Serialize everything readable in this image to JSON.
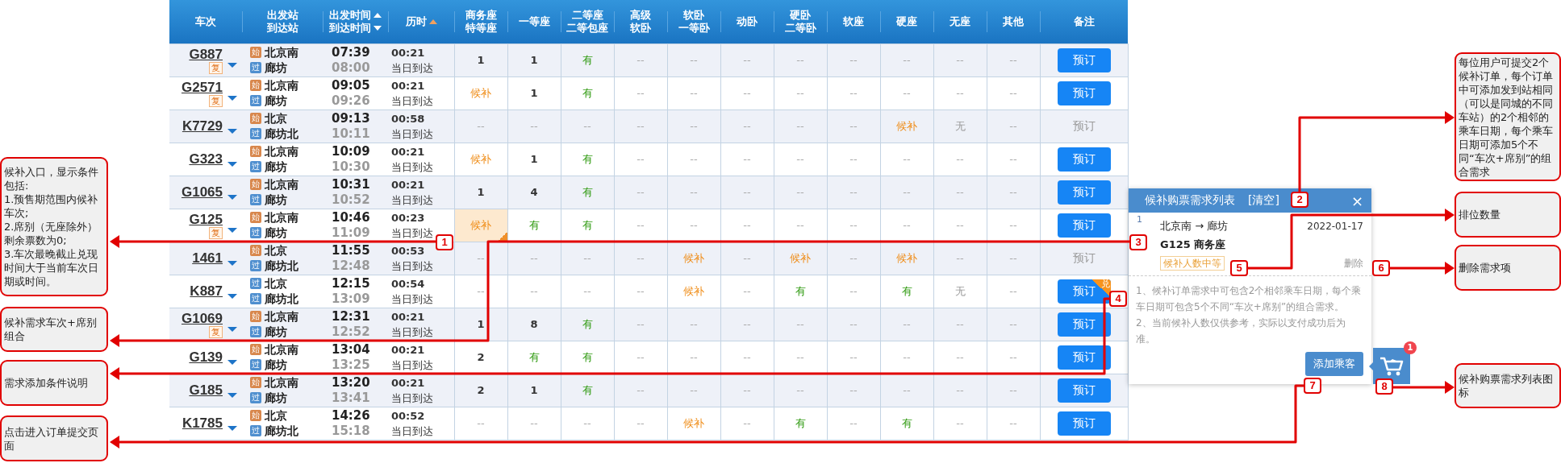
{
  "table": {
    "columns": [
      {
        "lines": [
          {
            "text": "车次",
            "kind": "plain"
          }
        ]
      },
      {
        "lines": [
          {
            "text": "出发站",
            "kind": "plain"
          },
          {
            "text": "到达站",
            "kind": "plain"
          }
        ]
      },
      {
        "lines": [
          {
            "text": "出发时间",
            "kind": "sort-up",
            "active": false
          },
          {
            "text": "到达时间",
            "kind": "sort-down",
            "active": false
          }
        ]
      },
      {
        "lines": [
          {
            "text": "历时",
            "kind": "sort-up",
            "active": true
          }
        ]
      },
      {
        "lines": [
          {
            "text": "商务座",
            "kind": "plain"
          },
          {
            "text": "特等座",
            "kind": "plain"
          }
        ]
      },
      {
        "lines": [
          {
            "text": "一等座",
            "kind": "plain"
          }
        ]
      },
      {
        "lines": [
          {
            "text": "二等座",
            "kind": "plain"
          },
          {
            "text": "二等包座",
            "kind": "plain"
          }
        ]
      },
      {
        "lines": [
          {
            "text": "高级",
            "kind": "plain"
          },
          {
            "text": "软卧",
            "kind": "plain"
          }
        ]
      },
      {
        "lines": [
          {
            "text": "软卧",
            "kind": "plain"
          },
          {
            "text": "一等卧",
            "kind": "plain"
          }
        ]
      },
      {
        "lines": [
          {
            "text": "动卧",
            "kind": "plain"
          }
        ]
      },
      {
        "lines": [
          {
            "text": "硬卧",
            "kind": "plain"
          },
          {
            "text": "二等卧",
            "kind": "plain"
          }
        ]
      },
      {
        "lines": [
          {
            "text": "软座",
            "kind": "plain"
          }
        ]
      },
      {
        "lines": [
          {
            "text": "硬座",
            "kind": "plain"
          }
        ]
      },
      {
        "lines": [
          {
            "text": "无座",
            "kind": "plain"
          }
        ]
      },
      {
        "lines": [
          {
            "text": "其他",
            "kind": "plain"
          }
        ]
      },
      {
        "lines": [
          {
            "text": "备注",
            "kind": "plain"
          }
        ]
      }
    ],
    "rows": [
      {
        "train": "G887",
        "badge": "复",
        "from": {
          "tag": "始",
          "kind": "start",
          "name": "北京南"
        },
        "to": {
          "tag": "过",
          "kind": "pass",
          "name": "廊坊"
        },
        "depart": "07:39",
        "arrive": "08:00",
        "duration": "00:21",
        "arrival_day": "当日到达",
        "seats": [
          {
            "t": "1",
            "kind": "num",
            "selected": false
          },
          {
            "t": "1",
            "kind": "num",
            "selected": false
          },
          {
            "t": "有",
            "kind": "yes",
            "selected": false
          },
          {
            "t": "--",
            "kind": "none",
            "selected": false
          },
          {
            "t": "--",
            "kind": "none",
            "selected": false
          },
          {
            "t": "--",
            "kind": "none",
            "selected": false
          },
          {
            "t": "--",
            "kind": "none",
            "selected": false
          },
          {
            "t": "--",
            "kind": "none",
            "selected": false
          },
          {
            "t": "--",
            "kind": "none",
            "selected": false
          },
          {
            "t": "--",
            "kind": "none",
            "selected": false
          },
          {
            "t": "--",
            "kind": "none",
            "selected": false
          }
        ],
        "book": {
          "label": "预订",
          "disabled": false
        }
      },
      {
        "train": "G2571",
        "badge": "复",
        "from": {
          "tag": "始",
          "kind": "start",
          "name": "北京南"
        },
        "to": {
          "tag": "过",
          "kind": "pass",
          "name": "廊坊"
        },
        "depart": "09:05",
        "arrive": "09:26",
        "duration": "00:21",
        "arrival_day": "当日到达",
        "seats": [
          {
            "t": "候补",
            "kind": "wait",
            "selected": false
          },
          {
            "t": "1",
            "kind": "num",
            "selected": false
          },
          {
            "t": "有",
            "kind": "yes",
            "selected": false
          },
          {
            "t": "--",
            "kind": "none",
            "selected": false
          },
          {
            "t": "--",
            "kind": "none",
            "selected": false
          },
          {
            "t": "--",
            "kind": "none",
            "selected": false
          },
          {
            "t": "--",
            "kind": "none",
            "selected": false
          },
          {
            "t": "--",
            "kind": "none",
            "selected": false
          },
          {
            "t": "--",
            "kind": "none",
            "selected": false
          },
          {
            "t": "--",
            "kind": "none",
            "selected": false
          },
          {
            "t": "--",
            "kind": "none",
            "selected": false
          }
        ],
        "book": {
          "label": "预订",
          "disabled": false
        }
      },
      {
        "train": "K7729",
        "from": {
          "tag": "始",
          "kind": "start",
          "name": "北京"
        },
        "to": {
          "tag": "过",
          "kind": "pass",
          "name": "廊坊北"
        },
        "depart": "09:13",
        "arrive": "10:11",
        "duration": "00:58",
        "arrival_day": "当日到达",
        "seats": [
          {
            "t": "--",
            "kind": "none",
            "selected": false
          },
          {
            "t": "--",
            "kind": "none",
            "selected": false
          },
          {
            "t": "--",
            "kind": "none",
            "selected": false
          },
          {
            "t": "--",
            "kind": "none",
            "selected": false
          },
          {
            "t": "--",
            "kind": "none",
            "selected": false
          },
          {
            "t": "--",
            "kind": "none",
            "selected": false
          },
          {
            "t": "--",
            "kind": "none",
            "selected": false
          },
          {
            "t": "--",
            "kind": "none",
            "selected": false
          },
          {
            "t": "候补",
            "kind": "wait",
            "selected": false
          },
          {
            "t": "无",
            "kind": "no",
            "selected": false
          },
          {
            "t": "--",
            "kind": "none",
            "selected": false
          }
        ],
        "book": {
          "label": "预订",
          "disabled": true
        }
      },
      {
        "train": "G323",
        "from": {
          "tag": "始",
          "kind": "start",
          "name": "北京南"
        },
        "to": {
          "tag": "过",
          "kind": "pass",
          "name": "廊坊"
        },
        "depart": "10:09",
        "arrive": "10:30",
        "duration": "00:21",
        "arrival_day": "当日到达",
        "seats": [
          {
            "t": "候补",
            "kind": "wait",
            "selected": false
          },
          {
            "t": "1",
            "kind": "num",
            "selected": false
          },
          {
            "t": "有",
            "kind": "yes",
            "selected": false
          },
          {
            "t": "--",
            "kind": "none",
            "selected": false
          },
          {
            "t": "--",
            "kind": "none",
            "selected": false
          },
          {
            "t": "--",
            "kind": "none",
            "selected": false
          },
          {
            "t": "--",
            "kind": "none",
            "selected": false
          },
          {
            "t": "--",
            "kind": "none",
            "selected": false
          },
          {
            "t": "--",
            "kind": "none",
            "selected": false
          },
          {
            "t": "--",
            "kind": "none",
            "selected": false
          },
          {
            "t": "--",
            "kind": "none",
            "selected": false
          }
        ],
        "book": {
          "label": "预订",
          "disabled": false
        }
      },
      {
        "train": "G1065",
        "from": {
          "tag": "始",
          "kind": "start",
          "name": "北京南"
        },
        "to": {
          "tag": "过",
          "kind": "pass",
          "name": "廊坊"
        },
        "depart": "10:31",
        "arrive": "10:52",
        "duration": "00:21",
        "arrival_day": "当日到达",
        "seats": [
          {
            "t": "1",
            "kind": "num",
            "selected": false
          },
          {
            "t": "4",
            "kind": "num",
            "selected": false
          },
          {
            "t": "有",
            "kind": "yes",
            "selected": false
          },
          {
            "t": "--",
            "kind": "none",
            "selected": false
          },
          {
            "t": "--",
            "kind": "none",
            "selected": false
          },
          {
            "t": "--",
            "kind": "none",
            "selected": false
          },
          {
            "t": "--",
            "kind": "none",
            "selected": false
          },
          {
            "t": "--",
            "kind": "none",
            "selected": false
          },
          {
            "t": "--",
            "kind": "none",
            "selected": false
          },
          {
            "t": "--",
            "kind": "none",
            "selected": false
          },
          {
            "t": "--",
            "kind": "none",
            "selected": false
          }
        ],
        "book": {
          "label": "预订",
          "disabled": false
        }
      },
      {
        "train": "G125",
        "badge": "复",
        "from": {
          "tag": "始",
          "kind": "start",
          "name": "北京南"
        },
        "to": {
          "tag": "过",
          "kind": "pass",
          "name": "廊坊"
        },
        "depart": "10:46",
        "arrive": "11:09",
        "duration": "00:23",
        "arrival_day": "当日到达",
        "seats": [
          {
            "t": "候补",
            "kind": "wait",
            "selected": true
          },
          {
            "t": "有",
            "kind": "yes",
            "selected": false
          },
          {
            "t": "有",
            "kind": "yes",
            "selected": false
          },
          {
            "t": "--",
            "kind": "none",
            "selected": false
          },
          {
            "t": "--",
            "kind": "none",
            "selected": false
          },
          {
            "t": "--",
            "kind": "none",
            "selected": false
          },
          {
            "t": "--",
            "kind": "none",
            "selected": false
          },
          {
            "t": "--",
            "kind": "none",
            "selected": false
          },
          {
            "t": "--",
            "kind": "none",
            "selected": false
          },
          {
            "t": "--",
            "kind": "none",
            "selected": false
          },
          {
            "t": "--",
            "kind": "none",
            "selected": false
          }
        ],
        "book": {
          "label": "预订",
          "disabled": false
        }
      },
      {
        "train": "1461",
        "from": {
          "tag": "始",
          "kind": "start",
          "name": "北京"
        },
        "to": {
          "tag": "过",
          "kind": "pass",
          "name": "廊坊北"
        },
        "depart": "11:55",
        "arrive": "12:48",
        "duration": "00:53",
        "arrival_day": "当日到达",
        "seats": [
          {
            "t": "--",
            "kind": "none",
            "selected": false
          },
          {
            "t": "--",
            "kind": "none",
            "selected": false
          },
          {
            "t": "--",
            "kind": "none",
            "selected": false
          },
          {
            "t": "--",
            "kind": "none",
            "selected": false
          },
          {
            "t": "候补",
            "kind": "wait",
            "selected": false
          },
          {
            "t": "--",
            "kind": "none",
            "selected": false
          },
          {
            "t": "候补",
            "kind": "wait",
            "selected": false
          },
          {
            "t": "--",
            "kind": "none",
            "selected": false
          },
          {
            "t": "候补",
            "kind": "wait",
            "selected": false
          },
          {
            "t": "--",
            "kind": "none",
            "selected": false
          },
          {
            "t": "--",
            "kind": "none",
            "selected": false
          }
        ],
        "book": {
          "label": "预订",
          "disabled": true
        }
      },
      {
        "train": "K887",
        "from": {
          "tag": "过",
          "kind": "pass",
          "name": "北京"
        },
        "to": {
          "tag": "过",
          "kind": "pass",
          "name": "廊坊北"
        },
        "depart": "12:15",
        "arrive": "13:09",
        "duration": "00:54",
        "arrival_day": "当日到达",
        "seats": [
          {
            "t": "--",
            "kind": "none",
            "selected": false
          },
          {
            "t": "--",
            "kind": "none",
            "selected": false
          },
          {
            "t": "--",
            "kind": "none",
            "selected": false
          },
          {
            "t": "--",
            "kind": "none",
            "selected": false
          },
          {
            "t": "候补",
            "kind": "wait",
            "selected": false
          },
          {
            "t": "--",
            "kind": "none",
            "selected": false
          },
          {
            "t": "有",
            "kind": "yes",
            "selected": false
          },
          {
            "t": "--",
            "kind": "none",
            "selected": false
          },
          {
            "t": "有",
            "kind": "yes",
            "selected": false
          },
          {
            "t": "无",
            "kind": "no",
            "selected": false
          },
          {
            "t": "--",
            "kind": "none",
            "selected": false
          }
        ],
        "book": {
          "label": "预订",
          "disabled": false,
          "badge": "兑"
        }
      },
      {
        "train": "G1069",
        "badge": "复",
        "from": {
          "tag": "始",
          "kind": "start",
          "name": "北京南"
        },
        "to": {
          "tag": "过",
          "kind": "pass",
          "name": "廊坊"
        },
        "depart": "12:31",
        "arrive": "12:52",
        "duration": "00:21",
        "arrival_day": "当日到达",
        "seats": [
          {
            "t": "1",
            "kind": "num",
            "selected": false
          },
          {
            "t": "8",
            "kind": "num",
            "selected": false
          },
          {
            "t": "有",
            "kind": "yes",
            "selected": false
          },
          {
            "t": "--",
            "kind": "none",
            "selected": false
          },
          {
            "t": "--",
            "kind": "none",
            "selected": false
          },
          {
            "t": "--",
            "kind": "none",
            "selected": false
          },
          {
            "t": "--",
            "kind": "none",
            "selected": false
          },
          {
            "t": "--",
            "kind": "none",
            "selected": false
          },
          {
            "t": "--",
            "kind": "none",
            "selected": false
          },
          {
            "t": "--",
            "kind": "none",
            "selected": false
          },
          {
            "t": "--",
            "kind": "none",
            "selected": false
          }
        ],
        "book": {
          "label": "预订",
          "disabled": false
        }
      },
      {
        "train": "G139",
        "from": {
          "tag": "始",
          "kind": "start",
          "name": "北京南"
        },
        "to": {
          "tag": "过",
          "kind": "pass",
          "name": "廊坊"
        },
        "depart": "13:04",
        "arrive": "13:25",
        "duration": "00:21",
        "arrival_day": "当日到达",
        "seats": [
          {
            "t": "2",
            "kind": "num",
            "selected": false
          },
          {
            "t": "有",
            "kind": "yes",
            "selected": false
          },
          {
            "t": "有",
            "kind": "yes",
            "selected": false
          },
          {
            "t": "--",
            "kind": "none",
            "selected": false
          },
          {
            "t": "--",
            "kind": "none",
            "selected": false
          },
          {
            "t": "--",
            "kind": "none",
            "selected": false
          },
          {
            "t": "--",
            "kind": "none",
            "selected": false
          },
          {
            "t": "--",
            "kind": "none",
            "selected": false
          },
          {
            "t": "--",
            "kind": "none",
            "selected": false
          },
          {
            "t": "--",
            "kind": "none",
            "selected": false
          },
          {
            "t": "--",
            "kind": "none",
            "selected": false
          }
        ],
        "book": {
          "label": "预订",
          "disabled": false
        }
      },
      {
        "train": "G185",
        "from": {
          "tag": "始",
          "kind": "start",
          "name": "北京南"
        },
        "to": {
          "tag": "过",
          "kind": "pass",
          "name": "廊坊"
        },
        "depart": "13:20",
        "arrive": "13:41",
        "duration": "00:21",
        "arrival_day": "当日到达",
        "seats": [
          {
            "t": "2",
            "kind": "num",
            "selected": false
          },
          {
            "t": "1",
            "kind": "num",
            "selected": false
          },
          {
            "t": "有",
            "kind": "yes",
            "selected": false
          },
          {
            "t": "--",
            "kind": "none",
            "selected": false
          },
          {
            "t": "--",
            "kind": "none",
            "selected": false
          },
          {
            "t": "--",
            "kind": "none",
            "selected": false
          },
          {
            "t": "--",
            "kind": "none",
            "selected": false
          },
          {
            "t": "--",
            "kind": "none",
            "selected": false
          },
          {
            "t": "--",
            "kind": "none",
            "selected": false
          },
          {
            "t": "--",
            "kind": "none",
            "selected": false
          },
          {
            "t": "--",
            "kind": "none",
            "selected": false
          }
        ],
        "book": {
          "label": "预订",
          "disabled": false
        }
      },
      {
        "train": "K1785",
        "from": {
          "tag": "始",
          "kind": "start",
          "name": "北京"
        },
        "to": {
          "tag": "过",
          "kind": "pass",
          "name": "廊坊北"
        },
        "depart": "14:26",
        "arrive": "15:18",
        "duration": "00:52",
        "arrival_day": "当日到达",
        "seats": [
          {
            "t": "--",
            "kind": "none",
            "selected": false
          },
          {
            "t": "--",
            "kind": "none",
            "selected": false
          },
          {
            "t": "--",
            "kind": "none",
            "selected": false
          },
          {
            "t": "--",
            "kind": "none",
            "selected": false
          },
          {
            "t": "候补",
            "kind": "wait",
            "selected": false
          },
          {
            "t": "--",
            "kind": "none",
            "selected": false
          },
          {
            "t": "有",
            "kind": "yes",
            "selected": false
          },
          {
            "t": "--",
            "kind": "none",
            "selected": false
          },
          {
            "t": "有",
            "kind": "yes",
            "selected": false
          },
          {
            "t": "--",
            "kind": "none",
            "selected": false
          },
          {
            "t": "--",
            "kind": "none",
            "selected": false
          }
        ],
        "book": {
          "label": "预订",
          "disabled": false
        }
      }
    ]
  },
  "popup": {
    "title": "候补购票需求列表",
    "clear": "[清空]",
    "close": "×",
    "item": {
      "index": "1",
      "route": "北京南 → 廊坊",
      "date": "2022-01-17",
      "train_seat": "G125 商务座",
      "tag": "候补人数中等",
      "delete": "删除"
    },
    "notes": [
      "1、候补订单需求中可包含2个相邻乘车日期，每个乘车日期可包含5个不同“车次+席别”的组合需求。",
      "2、当前候补人数仅供参考，实际以支付成功后为准。"
    ],
    "button": "添加乘客"
  },
  "cart": {
    "count": "1"
  },
  "callouts": [
    {
      "marker": "1",
      "lines": [
        "候补入口，显示条件包括:",
        "1.预售期范围内候补车次;",
        "2.席别（无座除外）剩余票数为0;",
        "3.车次最晚截止兑现时间大于当前车次日期或时间。"
      ]
    },
    {
      "marker": "3",
      "lines": [
        "候补需求车次+席别组合"
      ]
    },
    {
      "marker": "4",
      "lines": [
        "需求添加条件说明"
      ]
    },
    {
      "marker": "7",
      "lines": [
        "点击进入订单提交页面"
      ]
    },
    {
      "marker": "2",
      "lines": [
        "每位用户可提交2个候补订单，每个订单中可添加发到站相同（可以是同城的不同车站）的2个相邻的乘车日期，每个乘车日期可添加5个不同“车次+席别”的组合需求"
      ]
    },
    {
      "marker": "5",
      "lines": [
        "排位数量"
      ]
    },
    {
      "marker": "6",
      "lines": [
        "删除需求项"
      ]
    },
    {
      "marker": "8",
      "lines": [
        "候补购票需求列表图标"
      ]
    }
  ]
}
